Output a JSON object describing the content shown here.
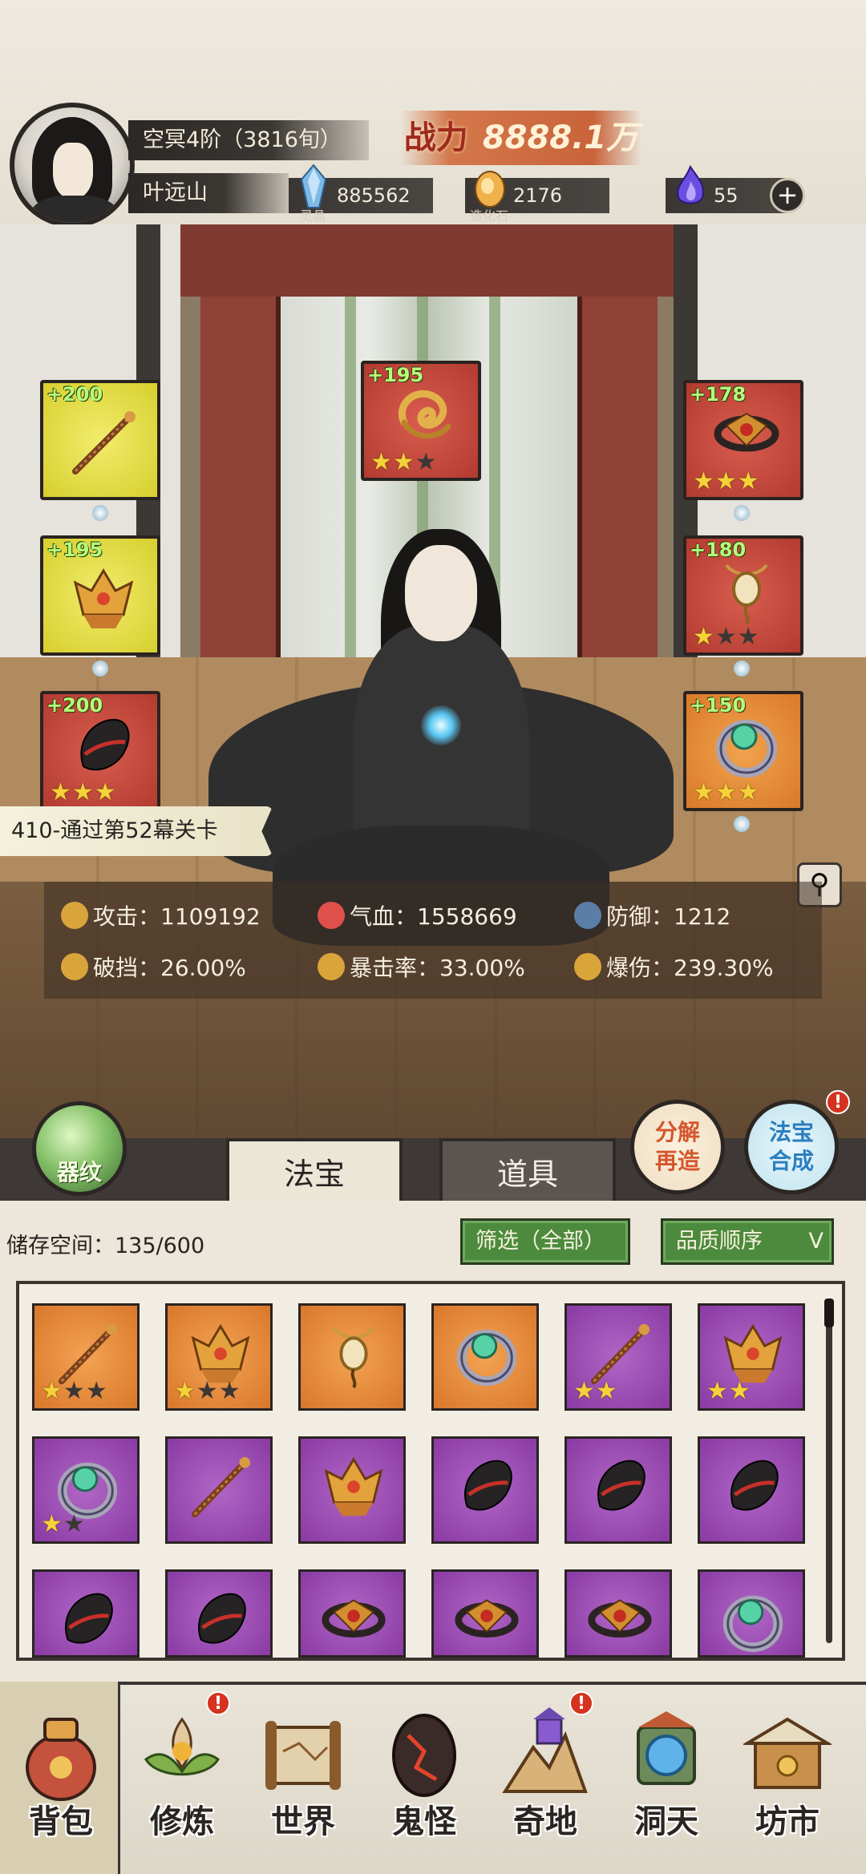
{
  "player": {
    "realm": "空冥4阶（3816旬）",
    "name": "叶远山",
    "power_label": "战力",
    "power_value": "8888.1万"
  },
  "resources": [
    {
      "icon": "spirit-crystal-icon",
      "label": "灵晶",
      "value": "885562"
    },
    {
      "icon": "creation-stone-icon",
      "label": "造化石",
      "value": "2176"
    },
    {
      "icon": "purple-flame-icon",
      "label": "",
      "value": "55"
    }
  ],
  "equipment_slots": [
    {
      "bonus": "+200",
      "quality": "gold",
      "stars_on": 0,
      "stars_total": 0
    },
    {
      "bonus": "+195",
      "quality": "gold",
      "stars_on": 0,
      "stars_total": 0
    },
    {
      "bonus": "+200",
      "quality": "red",
      "stars_on": 3,
      "stars_total": 3
    },
    {
      "bonus": "+195",
      "quality": "red",
      "stars_on": 2,
      "stars_total": 3
    },
    {
      "bonus": "+178",
      "quality": "red",
      "stars_on": 3,
      "stars_total": 3
    },
    {
      "bonus": "+180",
      "quality": "red",
      "stars_on": 1,
      "stars_total": 3
    },
    {
      "bonus": "+150",
      "quality": "orange",
      "stars_on": 3,
      "stars_total": 3
    }
  ],
  "mission": "410-通过第52幕关卡",
  "stats": [
    {
      "label": "攻击",
      "value": "1109192",
      "icon": "sword-icon",
      "color": "#d9a53a"
    },
    {
      "label": "气血",
      "value": "1558669",
      "icon": "heart-icon",
      "color": "#e0504a"
    },
    {
      "label": "防御",
      "value": "1212",
      "icon": "shield-icon",
      "color": "#5b7ea6"
    },
    {
      "label": "破挡",
      "value": "26.00%",
      "icon": "break-icon",
      "color": "#d9a53a"
    },
    {
      "label": "暴击率",
      "value": "33.00%",
      "icon": "crit-icon",
      "color": "#d9a53a"
    },
    {
      "label": "爆伤",
      "value": "239.30%",
      "icon": "crit-damage-icon",
      "color": "#d9a53a"
    }
  ],
  "buttons": {
    "qiwen": "器纹",
    "fenjie_1": "分解",
    "fenjie_2": "再造",
    "hecheng_1": "法宝",
    "hecheng_2": "合成",
    "alert": "!"
  },
  "tabs": [
    "法宝",
    "道具"
  ],
  "inventory": {
    "storage_label": "储存空间：",
    "storage_value": "135/600",
    "filter": "筛选（全部）",
    "sort": "品质顺序",
    "items": [
      {
        "quality": "orange",
        "type": "staff-icon",
        "stars_on": 1,
        "stars_total": 3
      },
      {
        "quality": "orange",
        "type": "lotus-crown-icon",
        "stars_on": 1,
        "stars_total": 3
      },
      {
        "quality": "orange",
        "type": "pendant-icon",
        "stars_on": 0,
        "stars_total": 0
      },
      {
        "quality": "orange",
        "type": "ring-icon",
        "stars_on": 0,
        "stars_total": 0
      },
      {
        "quality": "purple",
        "type": "staff-icon",
        "stars_on": 2,
        "stars_total": 2
      },
      {
        "quality": "purple",
        "type": "lotus-crown-icon",
        "stars_on": 2,
        "stars_total": 2
      },
      {
        "quality": "purple",
        "type": "ring-icon",
        "stars_on": 1,
        "stars_total": 2
      },
      {
        "quality": "purple",
        "type": "staff-icon",
        "stars_on": 0,
        "stars_total": 0
      },
      {
        "quality": "purple",
        "type": "lotus-crown-icon",
        "stars_on": 0,
        "stars_total": 0
      },
      {
        "quality": "purple",
        "type": "gauntlet-icon",
        "stars_on": 0,
        "stars_total": 0
      },
      {
        "quality": "purple",
        "type": "gauntlet-icon",
        "stars_on": 0,
        "stars_total": 0
      },
      {
        "quality": "purple",
        "type": "gauntlet-icon",
        "stars_on": 0,
        "stars_total": 0
      },
      {
        "quality": "purple",
        "type": "gauntlet-icon",
        "stars_on": 0,
        "stars_total": 0
      },
      {
        "quality": "purple",
        "type": "gauntlet-icon",
        "stars_on": 0,
        "stars_total": 0
      },
      {
        "quality": "purple",
        "type": "bracelet-icon",
        "stars_on": 0,
        "stars_total": 0
      },
      {
        "quality": "purple",
        "type": "bracelet-icon",
        "stars_on": 0,
        "stars_total": 0
      },
      {
        "quality": "purple",
        "type": "bracelet-icon",
        "stars_on": 0,
        "stars_total": 0
      },
      {
        "quality": "purple",
        "type": "ring-icon",
        "stars_on": 0,
        "stars_total": 0
      }
    ]
  },
  "nav": [
    {
      "label": "背包",
      "icon": "bag-icon",
      "active": true,
      "alert": false
    },
    {
      "label": "修炼",
      "icon": "lotus-icon",
      "active": false,
      "alert": true
    },
    {
      "label": "世界",
      "icon": "scroll-map-icon",
      "active": false,
      "alert": false
    },
    {
      "label": "鬼怪",
      "icon": "demon-egg-icon",
      "active": false,
      "alert": false
    },
    {
      "label": "奇地",
      "icon": "mountain-icon",
      "active": false,
      "alert": true
    },
    {
      "label": "洞天",
      "icon": "portal-icon",
      "active": false,
      "alert": false
    },
    {
      "label": "坊市",
      "icon": "market-stall-icon",
      "active": false,
      "alert": false
    }
  ],
  "colors": {
    "gold_slot": "#e2dc3f",
    "red_slot": "#c2473a",
    "orange_slot": "#e38b37",
    "purple_cell": "#9b49b3",
    "bonus_text": "#b5ff7a",
    "star": "#f5d23a"
  }
}
